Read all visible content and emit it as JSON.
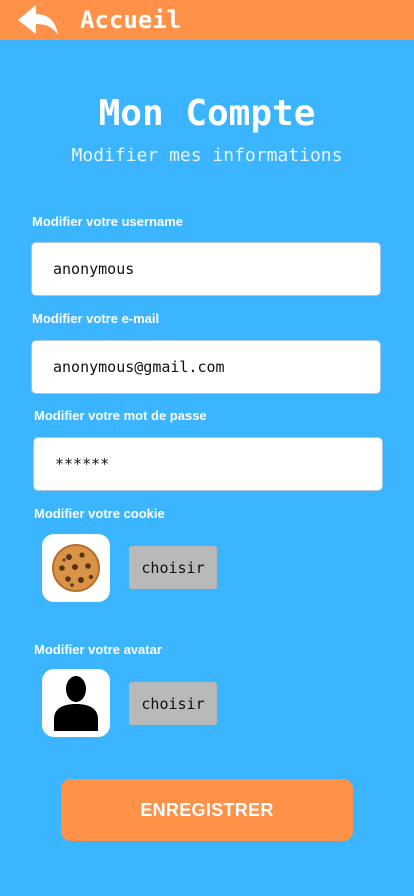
{
  "header": {
    "back_label": "Accueil",
    "back_icon": "reply-arrow-icon",
    "bar_color": "#ff9148"
  },
  "page": {
    "title": "Mon Compte",
    "subtitle": "Modifier mes informations",
    "background_color": "#3bb5ff"
  },
  "form": {
    "username": {
      "label": "Modifier votre username",
      "value": "anonymous"
    },
    "email": {
      "label": "Modifier votre e-mail",
      "value": "anonymous@gmail.com"
    },
    "password": {
      "label": "Modifier votre mot de passe",
      "value": "******"
    },
    "cookie": {
      "label": "Modifier votre cookie",
      "icon": "cookie-icon",
      "button_label": "choisir"
    },
    "avatar": {
      "label": "Modifier votre avatar",
      "icon": "person-silhouette-icon",
      "button_label": "choisir"
    }
  },
  "actions": {
    "save_label": "ENREGISTRER",
    "save_color": "#ff9148"
  }
}
